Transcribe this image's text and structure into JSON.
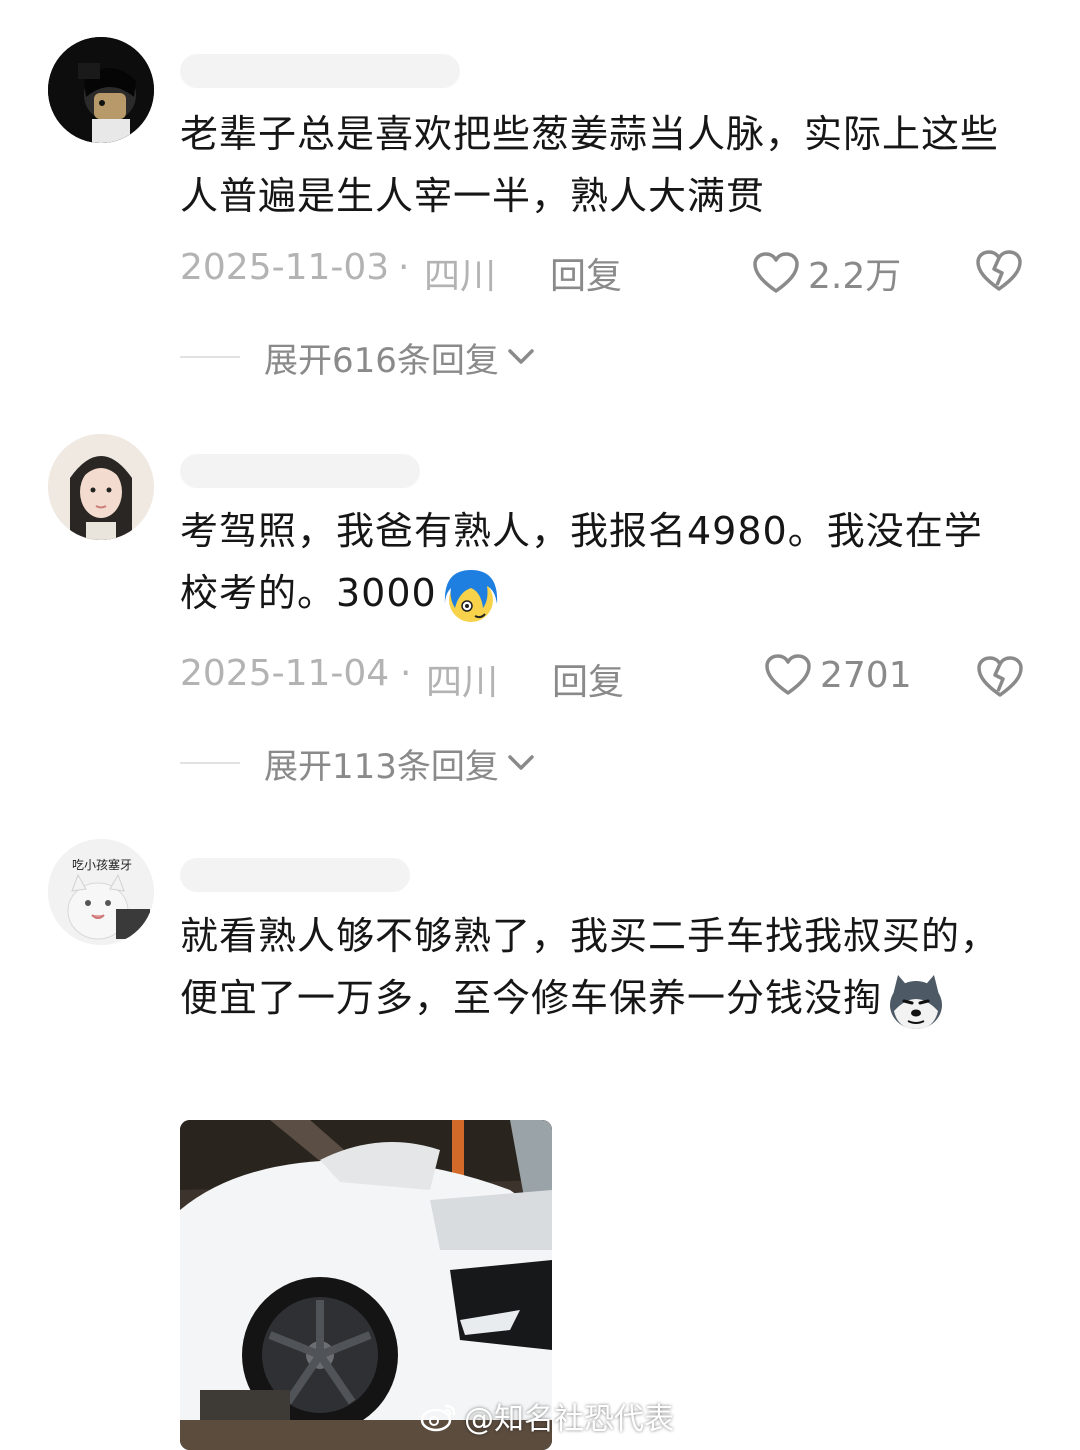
{
  "comments": [
    {
      "text": "老辈子总是喜欢把些葱姜蒜当人脉，实际上这些人普遍是生人宰一半，熟人大满贯",
      "date": "2025-11-03",
      "separator": "·",
      "region": "四川",
      "reply_label": "回复",
      "likes": "2.2万",
      "expand_label": "展开616条回复"
    },
    {
      "text": "考驾照，我爸有熟人，我报名4980。我没在学校考的。3000",
      "date": "2025-11-04",
      "separator": "·",
      "region": "四川",
      "reply_label": "回复",
      "likes": "2701",
      "expand_label": "展开113条回复"
    },
    {
      "text": "就看熟人够不够熟了，我买二手车找我叔买的，便宜了一万多，至今修车保养一分钱没掏",
      "avatar_caption": "吃小孩塞牙"
    }
  ],
  "watermark": "@知名社恐代表",
  "icons": {
    "like": "heart-outline-icon",
    "dislike": "broken-heart-icon",
    "expand": "chevron-down-icon",
    "watermark": "weibo-logo-icon"
  },
  "colors": {
    "text": "#161616",
    "meta": "#b3b3b3",
    "secondary": "#8a8a8a"
  }
}
